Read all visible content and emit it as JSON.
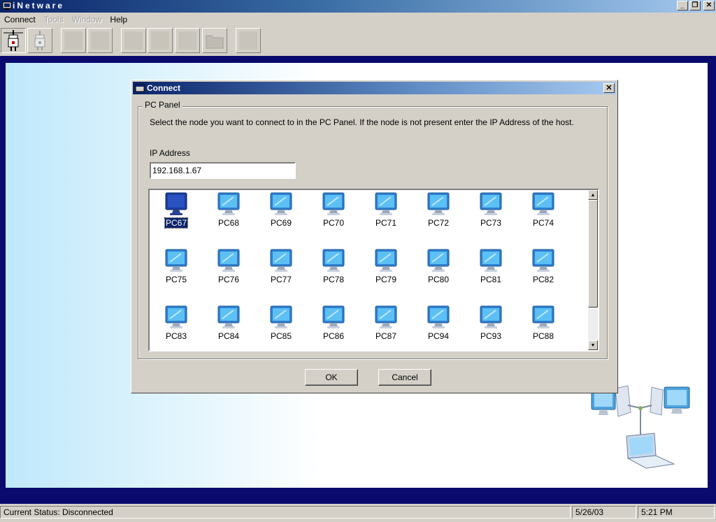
{
  "app": {
    "title": "iNetware",
    "window_buttons": {
      "minimize": "_",
      "restore": "❐",
      "close": "✕"
    }
  },
  "menu": {
    "items": [
      {
        "label": "Connect",
        "enabled": true
      },
      {
        "label": "Tools",
        "enabled": false
      },
      {
        "label": "Window",
        "enabled": false
      },
      {
        "label": "Help",
        "enabled": true
      }
    ]
  },
  "toolbar": {
    "buttons": [
      {
        "icon": "connect-plug-icon",
        "enabled": true,
        "pressed": true
      },
      {
        "icon": "disconnect-plug-icon",
        "enabled": false
      },
      {
        "icon": "blank",
        "enabled": false
      },
      {
        "icon": "blank",
        "enabled": false
      },
      {
        "icon": "blank",
        "enabled": false
      },
      {
        "icon": "blank",
        "enabled": false
      },
      {
        "icon": "blank",
        "enabled": false
      },
      {
        "icon": "folder-icon",
        "enabled": false
      },
      {
        "icon": "blank",
        "enabled": false
      }
    ]
  },
  "dialog": {
    "title": "Connect",
    "close_glyph": "✕",
    "group_label": "PC Panel",
    "instructions": "Select the node you want to connect to in the PC Panel.  If the node is not present enter the IP Address of the host.",
    "ip_label": "IP Address",
    "ip_value": "192.168.1.67",
    "nodes": [
      "PC67",
      "PC68",
      "PC69",
      "PC70",
      "PC71",
      "PC72",
      "PC73",
      "PC74",
      "PC75",
      "PC76",
      "PC77",
      "PC78",
      "PC79",
      "PC80",
      "PC81",
      "PC82",
      "PC83",
      "PC84",
      "PC85",
      "PC86",
      "PC87",
      "PC94",
      "PC93",
      "PC88"
    ],
    "selected_node": "PC67",
    "ok_label": "OK",
    "cancel_label": "Cancel"
  },
  "status": {
    "text": "Current Status: Disconnected",
    "date": "5/26/03",
    "time": "5:21 PM"
  },
  "colors": {
    "title_bar": "#0a246a",
    "workspace_frame": "#0a0a6e",
    "selection": "#0a246a",
    "window_face": "#d4d0c8"
  }
}
